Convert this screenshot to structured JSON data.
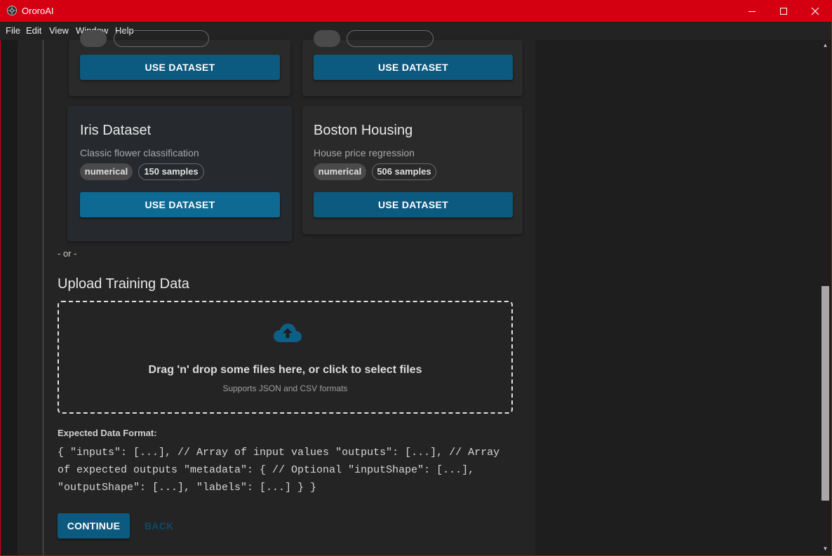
{
  "window": {
    "title": "OroroAI",
    "controls": [
      "minimize-icon",
      "maximize-icon",
      "close-icon"
    ]
  },
  "menu": [
    "File",
    "Edit",
    "View",
    "Window",
    "Help"
  ],
  "datasets": [
    {
      "title": "",
      "description": "",
      "type": "",
      "samples": "",
      "button": "USE DATASET"
    },
    {
      "title": "",
      "description": "",
      "type": "",
      "samples": "",
      "button": "USE DATASET"
    },
    {
      "title": "Iris Dataset",
      "description": "Classic flower classification",
      "type": "numerical",
      "samples": "150 samples",
      "button": "USE DATASET"
    },
    {
      "title": "Boston Housing",
      "description": "House price regression",
      "type": "numerical",
      "samples": "506 samples",
      "button": "USE DATASET"
    }
  ],
  "separator": "- or -",
  "upload": {
    "title": "Upload Training Data",
    "icon": "cloud-upload-icon",
    "main_text": "Drag 'n' drop some files here, or click to select files",
    "sub_text": "Supports JSON and CSV formats"
  },
  "format": {
    "label": "Expected Data Format:",
    "code": "{ \"inputs\": [...], // Array of input values \"outputs\": [...], // Array of expected outputs \"metadata\": { // Optional \"inputShape\": [...], \"outputShape\": [...], \"labels\": [...] } }"
  },
  "actions": {
    "continue": "CONTINUE",
    "back": "BACK"
  },
  "colors": {
    "titlebar": "#d40012",
    "primary_button": "#0d5a80",
    "upload_icon": "#0e5f86"
  }
}
